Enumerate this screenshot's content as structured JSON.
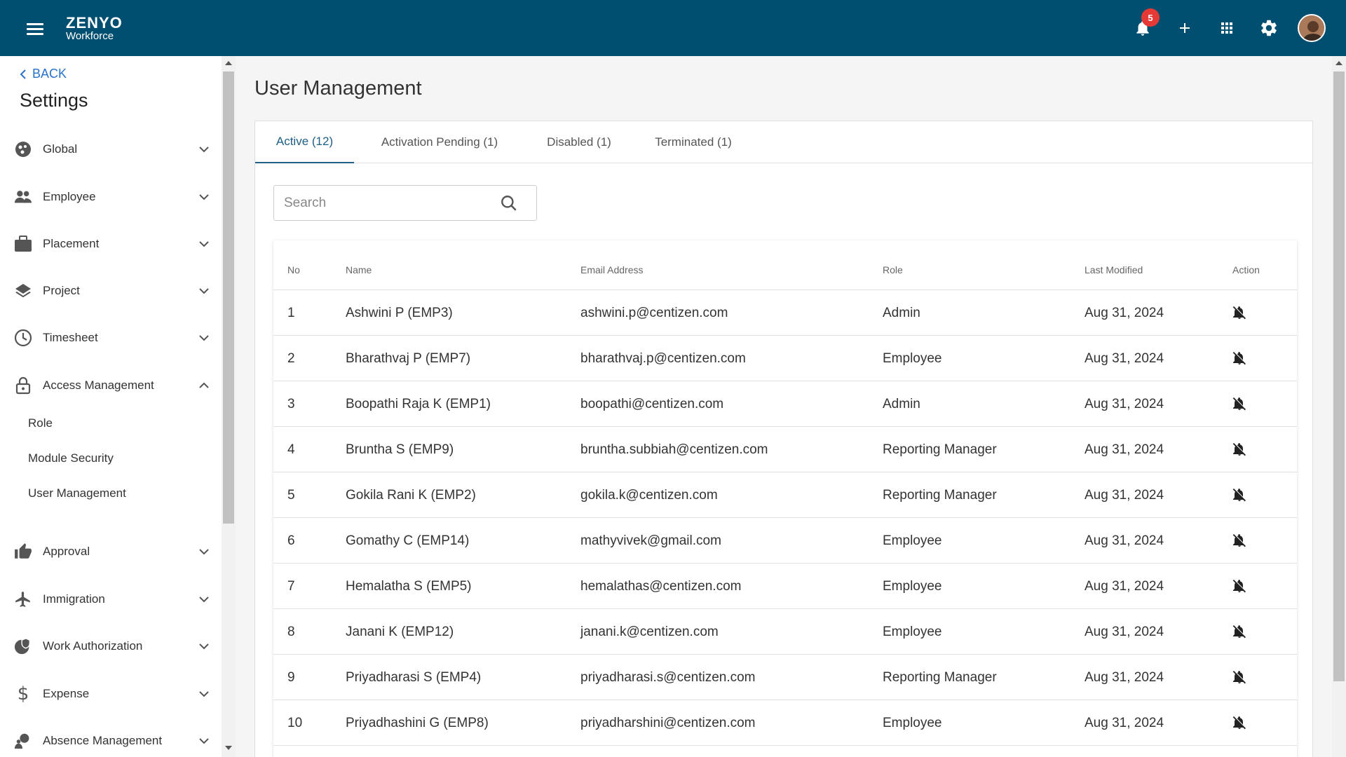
{
  "header": {
    "logo_top": "ZENYO",
    "logo_bottom": "Workforce",
    "notification_count": "5",
    "icons": [
      "menu-icon",
      "bell-icon",
      "plus-icon",
      "apps-grid-icon",
      "gear-icon",
      "avatar"
    ]
  },
  "sidebar": {
    "back_label": "BACK",
    "title": "Settings",
    "items": [
      {
        "label": "Global",
        "icon": "globe-icon",
        "expanded": false
      },
      {
        "label": "Employee",
        "icon": "people-icon",
        "expanded": false
      },
      {
        "label": "Placement",
        "icon": "briefcase-icon",
        "expanded": false
      },
      {
        "label": "Project",
        "icon": "layers-icon",
        "expanded": false
      },
      {
        "label": "Timesheet",
        "icon": "clock-icon",
        "expanded": false
      },
      {
        "label": "Access Management",
        "icon": "lock-icon",
        "expanded": true
      },
      {
        "label": "Approval",
        "icon": "thumbs-up-icon",
        "expanded": false
      },
      {
        "label": "Immigration",
        "icon": "airplane-icon",
        "expanded": false
      },
      {
        "label": "Work Authorization",
        "icon": "globe-shield-icon",
        "expanded": false
      },
      {
        "label": "Expense",
        "icon": "dollar-icon",
        "expanded": false
      },
      {
        "label": "Absence Management",
        "icon": "person-beach-icon",
        "expanded": false
      }
    ],
    "sub_items": [
      "Role",
      "Module Security",
      "User Management"
    ]
  },
  "main": {
    "title": "User Management",
    "tabs": [
      {
        "label": "Active (12)",
        "active": true
      },
      {
        "label": "Activation Pending (1)",
        "active": false
      },
      {
        "label": "Disabled (1)",
        "active": false
      },
      {
        "label": "Terminated (1)",
        "active": false
      }
    ],
    "search": {
      "placeholder": "Search",
      "value": ""
    },
    "table": {
      "headers": [
        "No",
        "Name",
        "Email Address",
        "Role",
        "Last Modified",
        "Action"
      ],
      "rows": [
        {
          "no": "1",
          "name": "Ashwini P (EMP3)",
          "email": "ashwini.p@centizen.com",
          "role": "Admin",
          "modified": "Aug 31, 2024"
        },
        {
          "no": "2",
          "name": "Bharathvaj P (EMP7)",
          "email": "bharathvaj.p@centizen.com",
          "role": "Employee",
          "modified": "Aug 31, 2024"
        },
        {
          "no": "3",
          "name": "Boopathi Raja K (EMP1)",
          "email": "boopathi@centizen.com",
          "role": "Admin",
          "modified": "Aug 31, 2024"
        },
        {
          "no": "4",
          "name": "Bruntha S (EMP9)",
          "email": "bruntha.subbiah@centizen.com",
          "role": "Reporting Manager",
          "modified": "Aug 31, 2024"
        },
        {
          "no": "5",
          "name": "Gokila Rani K (EMP2)",
          "email": "gokila.k@centizen.com",
          "role": "Reporting Manager",
          "modified": "Aug 31, 2024"
        },
        {
          "no": "6",
          "name": "Gomathy C (EMP14)",
          "email": "mathyvivek@gmail.com",
          "role": "Employee",
          "modified": "Aug 31, 2024"
        },
        {
          "no": "7",
          "name": "Hemalatha S (EMP5)",
          "email": "hemalathas@centizen.com",
          "role": "Employee",
          "modified": "Aug 31, 2024"
        },
        {
          "no": "8",
          "name": "Janani K (EMP12)",
          "email": "janani.k@centizen.com",
          "role": "Employee",
          "modified": "Aug 31, 2024"
        },
        {
          "no": "9",
          "name": "Priyadharasi S (EMP4)",
          "email": "priyadharasi.s@centizen.com",
          "role": "Reporting Manager",
          "modified": "Aug 31, 2024"
        },
        {
          "no": "10",
          "name": "Priyadhashini G (EMP8)",
          "email": "priyadharshini@centizen.com",
          "role": "Employee",
          "modified": "Aug 31, 2024"
        }
      ]
    }
  },
  "colors": {
    "header_bg": "#004e70",
    "accent": "#1f5f86",
    "link": "#2a72c9",
    "badge": "#e53935",
    "logo_accent": "#f26b3a"
  }
}
